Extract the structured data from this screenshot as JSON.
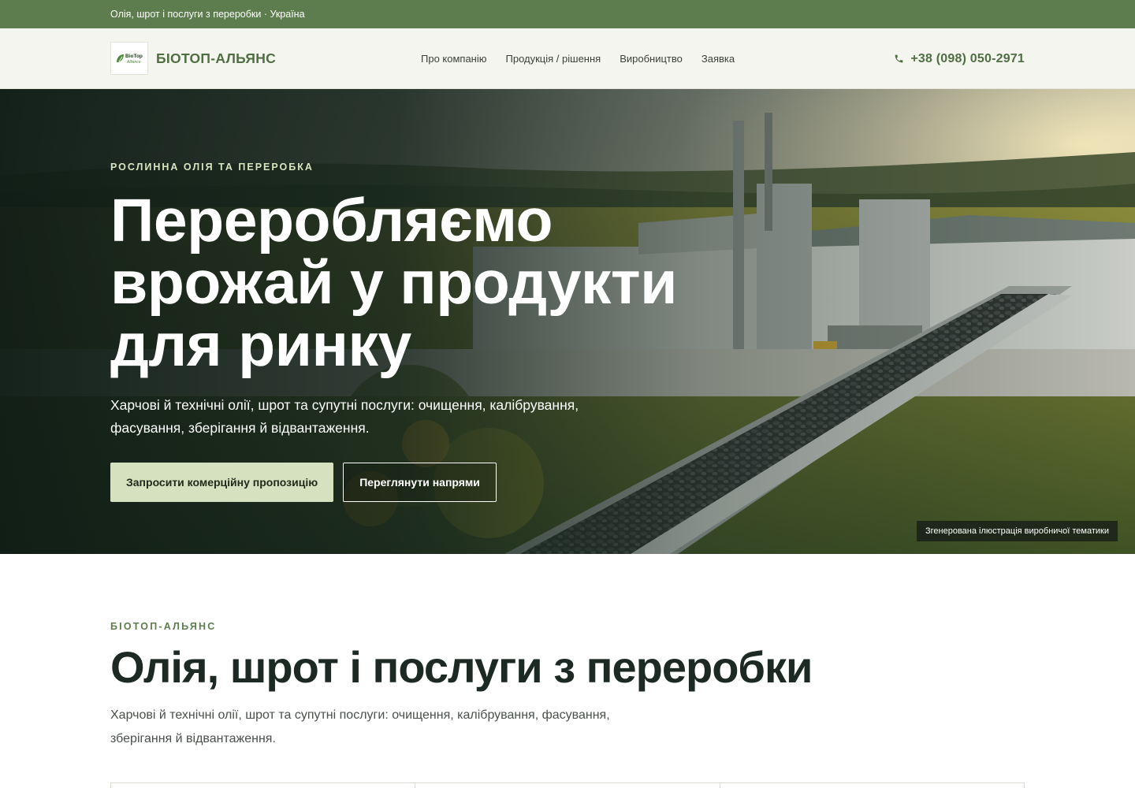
{
  "topbar": {
    "text": "Олія, шрот і послуги з переробки · Україна"
  },
  "header": {
    "brand": "БІОТОП-АЛЬЯНС",
    "logo_text_1": "BioTop",
    "logo_text_2": "Alliance",
    "nav": [
      {
        "label": "Про компанію"
      },
      {
        "label": "Продукція / рішення"
      },
      {
        "label": "Виробництво"
      },
      {
        "label": "Заявка"
      }
    ],
    "phone": "+38 (098) 050-2971",
    "icons": {
      "phone": "phone-icon",
      "logo": "leaf-logo-icon"
    }
  },
  "hero": {
    "eyebrow": "РОСЛИННА ОЛІЯ ТА ПЕРЕРОБКА",
    "title_line1": "Переробляємо",
    "title_line2": "врожай у продукти",
    "title_line3": "для ринку",
    "subtitle": "Харчові й технічні олії, шрот та супутні послуги: очищення, калібрування, фасування, зберігання й відвантаження.",
    "primary_cta": "Запросити комерційну пропозицію",
    "secondary_cta": "Переглянути напрями",
    "caption": "Згенерована ілюстрація виробничої тематики"
  },
  "about": {
    "eyebrow": "БІОТОП-АЛЬЯНС",
    "title": "Олія, шрот і послуги з переробки",
    "text": "Харчові й технічні олії, шрот та супутні послуги: очищення, калібрування, фасування, зберігання й відвантаження."
  },
  "colors": {
    "accent": "#5e7d4f",
    "brand_text": "#4f6e42",
    "primary_button": "#d5e1bf",
    "header_bg": "#f5f5f0",
    "dark_text": "#1d2a24"
  }
}
